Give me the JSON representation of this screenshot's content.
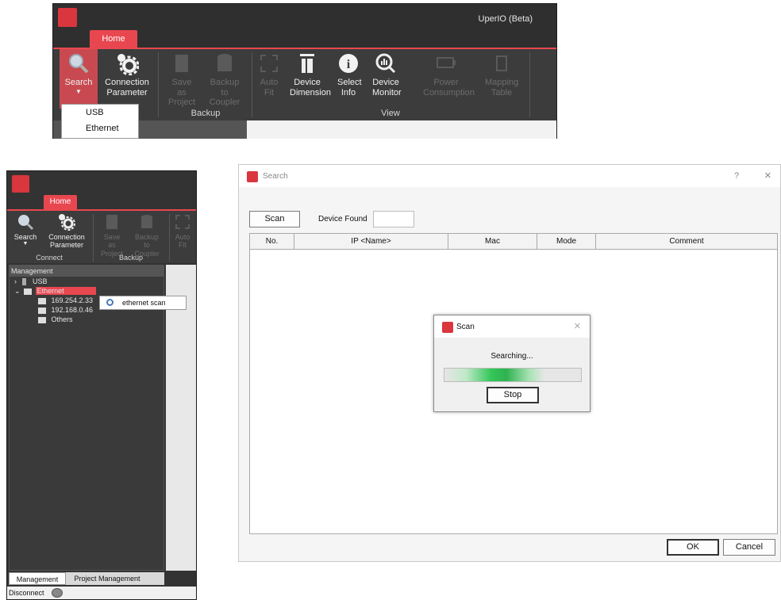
{
  "top_ribbon": {
    "app_title": "UperIO (Beta)",
    "home_tab": "Home",
    "buttons": {
      "search": "Search",
      "connection": "Connection Parameter",
      "save_as": "Save as Project",
      "backup": "Backup to Coupler",
      "auto_fit": "Auto Fit",
      "device_dimension": "Device Dimension",
      "select_info": "Select Info",
      "device_monitor": "Device Monitor",
      "power": "Power Consumption",
      "mapping": "Mapping Table"
    },
    "groups": {
      "backup": "Backup",
      "view": "View"
    },
    "search_menu": [
      "USB",
      "Ethernet"
    ]
  },
  "left_app": {
    "home_tab": "Home",
    "buttons": {
      "search": "Search",
      "connection": "Connection Parameter",
      "save_as": "Save as Project",
      "backup": "Backup to Coupler",
      "auto_fit": "Auto Fit"
    },
    "groups": {
      "connect": "Connect",
      "backup": "Backup"
    },
    "panel_title": "Management",
    "tree": {
      "usb": "USB",
      "ethernet": "Ethernet",
      "children": [
        "169.254.2.33",
        "192.168.0.46",
        "Others"
      ]
    },
    "context_menu": "ethernet scan",
    "bottom_tabs": [
      "Management",
      "Project Management"
    ],
    "status": "Disconnect"
  },
  "search_dialog": {
    "title": "Search",
    "help": "?",
    "close": "×",
    "scan_button": "Scan",
    "device_found_label": "Device Found",
    "device_found_value": "",
    "columns": [
      "No.",
      "IP <Name>",
      "Mac",
      "Mode",
      "Comment"
    ],
    "ok": "OK",
    "cancel": "Cancel"
  },
  "scan_dialog": {
    "title": "Scan",
    "close": "×",
    "status": "Searching...",
    "progress_fraction": 0.45,
    "stop": "Stop"
  },
  "colors": {
    "accent": "#e9474f",
    "dark_bg": "#3c3c3c",
    "progress": "#34c759"
  }
}
